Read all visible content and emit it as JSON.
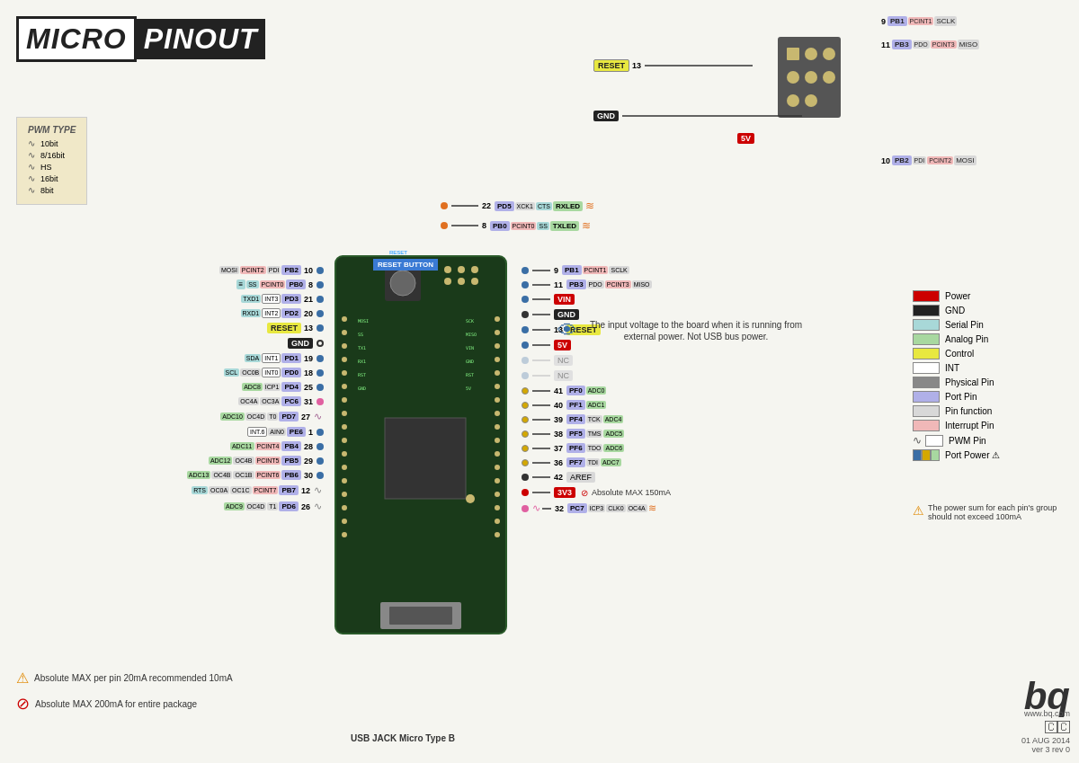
{
  "title": {
    "micro": "MICRO",
    "pinout": "PINOUT"
  },
  "pwm_legend": {
    "title": "PWM TYPE",
    "items": [
      {
        "wave": "∿",
        "label": "10bit"
      },
      {
        "wave": "∿",
        "label": "8/16bit"
      },
      {
        "wave": "∿",
        "label": "HS"
      },
      {
        "wave": "∿",
        "label": "16bit"
      },
      {
        "wave": "∿",
        "label": "8bit"
      }
    ]
  },
  "legend": {
    "items": [
      {
        "color": "#cc0000",
        "label": "Power"
      },
      {
        "color": "#222222",
        "label": "GND"
      },
      {
        "color": "#a8d8d8",
        "label": "Serial Pin"
      },
      {
        "color": "#a8d8a0",
        "label": "Analog Pin"
      },
      {
        "color": "#e8e840",
        "label": "Control"
      },
      {
        "color": "#ffffff",
        "label": "INT"
      },
      {
        "color": "#888888",
        "label": "Physical Pin"
      },
      {
        "color": "#b0b0e8",
        "label": "Port Pin"
      },
      {
        "color": "#d8d8d8",
        "label": "Pin function"
      },
      {
        "color": "#f0b8b8",
        "label": "Interrupt Pin"
      },
      {
        "color": "#ffffff",
        "label": "PWM Pin"
      },
      {
        "color": "multiport",
        "label": "Port Power ⚠"
      }
    ]
  },
  "top_pins": {
    "reset_label": "RESET",
    "reset_num": "13",
    "pin9": {
      "num": "9",
      "port": "PB1",
      "func1": "PCINT1",
      "func2": "SCLK"
    },
    "pin11": {
      "num": "11",
      "port": "PB3",
      "func1": "PDO",
      "func2": "PCINT3",
      "func3": "MISO"
    },
    "pin10": {
      "num": "10",
      "port": "PB2",
      "func1": "PDI",
      "func2": "PCINT2",
      "func3": "MOSI"
    },
    "gnd_label": "GND",
    "v5_label": "5V"
  },
  "top_side_pins": {
    "pin22": {
      "num": "22",
      "port": "PD5",
      "func1": "XCK1",
      "func2": "CTS",
      "func3": "RXLED"
    },
    "pin8": {
      "num": "8",
      "port": "PB0",
      "func1": "PCINT0",
      "func2": "SS",
      "func3": "TXLED"
    }
  },
  "right_pins": [
    {
      "num": "9",
      "port": "PB1",
      "func1": "PCINT1",
      "func2": "SCLK",
      "color": "blue"
    },
    {
      "num": "11",
      "port": "PB3",
      "func1": "PDO",
      "func2": "PCINT3",
      "func3": "MISO",
      "color": "blue"
    },
    {
      "label": "VIN",
      "type": "power",
      "color": "red"
    },
    {
      "label": "GND",
      "type": "gnd"
    },
    {
      "num": "13",
      "label": "RESET",
      "type": "control"
    },
    {
      "label": "5V",
      "type": "power"
    },
    {
      "label": "NC",
      "type": "nc"
    },
    {
      "label": "NC",
      "type": "nc"
    },
    {
      "num": "41",
      "port": "PF0",
      "func1": "ADC0",
      "color": "yellow"
    },
    {
      "num": "40",
      "port": "PF1",
      "func1": "ADC1",
      "color": "yellow"
    },
    {
      "num": "39",
      "port": "PF4",
      "func1": "TCK",
      "func2": "ADC4",
      "color": "yellow"
    },
    {
      "num": "38",
      "port": "PF5",
      "func1": "TMS",
      "func2": "ADC5",
      "color": "yellow"
    },
    {
      "num": "37",
      "port": "PF6",
      "func1": "TDO",
      "func2": "ADC6",
      "color": "yellow"
    },
    {
      "num": "36",
      "port": "PF7",
      "func1": "TDI",
      "func2": "ADC7",
      "color": "yellow"
    },
    {
      "num": "42",
      "label": "AREF",
      "type": "ref"
    },
    {
      "label": "3V3",
      "type": "power"
    },
    {
      "num": "32",
      "port": "PC7",
      "func1": "ICP3",
      "func2": "CLK0",
      "func3": "OC4A",
      "color": "pink"
    }
  ],
  "left_pins": [
    {
      "funcs": [
        "MOSI",
        "PCINT2",
        "PDI",
        "PB2"
      ],
      "num": "10"
    },
    {
      "funcs": [
        "SS",
        "PCINT0",
        "PB0"
      ],
      "num": "8"
    },
    {
      "funcs": [
        "TXD1",
        "INT3",
        "PD3"
      ],
      "num": "21"
    },
    {
      "funcs": [
        "RXD1",
        "INT2",
        "PD2"
      ],
      "num": "20"
    },
    {
      "label": "RESET",
      "num": "13"
    },
    {
      "label": "GND"
    },
    {
      "funcs": [
        "SDA",
        "INT1",
        "PD1"
      ],
      "num": "19"
    },
    {
      "funcs": [
        "SCL",
        "OC0B",
        "INT0",
        "PD0"
      ],
      "num": "18"
    },
    {
      "funcs": [
        "ADC8",
        "ICP1",
        "PD4"
      ],
      "num": "25"
    },
    {
      "funcs": [
        "OC4A",
        "OC3A",
        "PC6"
      ],
      "num": "31"
    },
    {
      "funcs": [
        "ADC10",
        "OC4D",
        "T0",
        "PD7"
      ],
      "num": "27"
    },
    {
      "funcs": [
        "INT.6",
        "AIN0",
        "PE6"
      ],
      "num": "1"
    },
    {
      "funcs": [
        "ADC11",
        "PCINT4",
        "PB4"
      ],
      "num": "28"
    },
    {
      "funcs": [
        "ADC12",
        "OC4B",
        "PCINT5",
        "PB5"
      ],
      "num": "29"
    },
    {
      "funcs": [
        "ADC13",
        "OC4B",
        "OC1B",
        "PCINT6",
        "PB6"
      ],
      "num": "30"
    },
    {
      "funcs": [
        "RTS",
        "OC0A",
        "OC1C",
        "PCINT7",
        "PB7"
      ],
      "num": "12"
    },
    {
      "funcs": [
        "ADC9",
        "OC4D",
        "T1",
        "PD6"
      ],
      "num": "26"
    }
  ],
  "info_bubble": {
    "text": "The input voltage to the board when\nit is running from external power.\nNot USB bus power."
  },
  "warnings": {
    "abs_max_pin": "Absolute MAX per pin 20mA\nrecommended 10mA",
    "abs_max_pkg": "Absolute MAX 200mA\nfor entire package",
    "power_sum": "The power sum for each pin's\ngroup should not exceed 100mA"
  },
  "board": {
    "reset_button": "RESET BUTTON",
    "usb_jack": "USB JACK\nMicro Type B"
  },
  "version": {
    "date": "01 AUG 2014",
    "ver": "ver 3 rev 0",
    "website": "www.bq.com"
  }
}
